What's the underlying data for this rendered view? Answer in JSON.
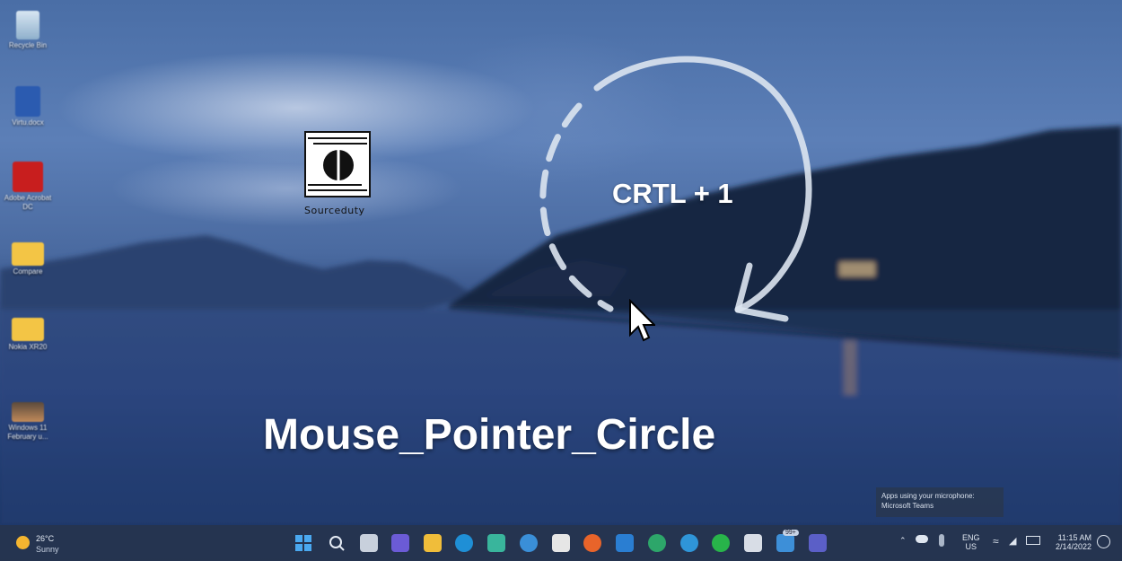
{
  "desktop_icons": [
    {
      "name": "recycle-bin",
      "label": "Recycle Bin"
    },
    {
      "name": "word-doc",
      "label": "Virtu.docx"
    },
    {
      "name": "adobe-acrobat",
      "label": "Adobe Acrobat DC"
    },
    {
      "name": "folder-compare",
      "label": "Compare"
    },
    {
      "name": "folder-nokia",
      "label": "Nokia XR20"
    },
    {
      "name": "windows-11-video",
      "label": "Windows 11 February u..."
    }
  ],
  "overlay": {
    "logo_text": "Sourceduty",
    "shortcut": "CRTL + 1",
    "headline": "Mouse_Pointer_Circle"
  },
  "notification": {
    "line1": "Apps using your microphone:",
    "line2": "Microsoft Teams"
  },
  "taskbar": {
    "weather_temp": "26°C",
    "weather_cond": "Sunny",
    "language": "ENG",
    "region": "US",
    "time": "11:15 AM",
    "date": "2/14/2022",
    "teams_badge": "99+"
  },
  "colors": {
    "accent": "#ffffff",
    "taskbar": "#26344e"
  }
}
